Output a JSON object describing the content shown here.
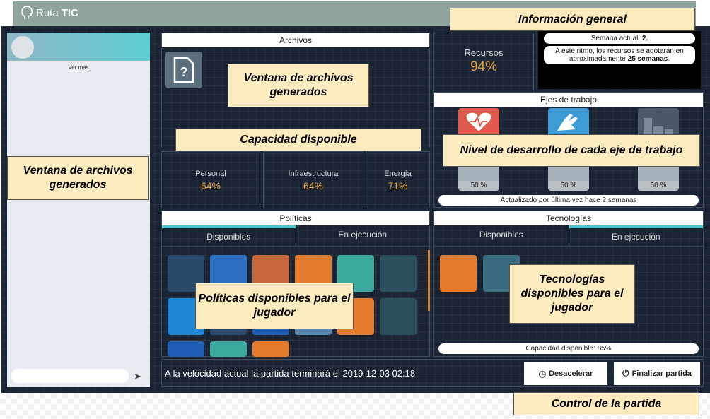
{
  "app": {
    "logo_prefix": "Ruta",
    "logo_suffix": "TIC"
  },
  "sidebar": {
    "ver_mas": "Ver mas"
  },
  "archivos": {
    "title": "Archivos",
    "file_icon": "question-document-icon"
  },
  "recursos": {
    "label": "Recursos",
    "value": "94%"
  },
  "info": {
    "semana_prefix": "Semana actual: ",
    "semana_value": "2.",
    "ritmo_prefix": "A este ritmo, los recursos se agotarán en aproximadamente ",
    "ritmo_value": "25 semanas",
    "ritmo_suffix": "."
  },
  "capacidad": [
    {
      "label": "Personal",
      "value": "64%"
    },
    {
      "label": "Infraestructura",
      "value": "64%"
    },
    {
      "label": "Energía",
      "value": "71%"
    }
  ],
  "ejes": {
    "title": "Ejes de trabajo",
    "items": [
      {
        "icon": "heart-pulse-icon",
        "color": "#e05a4e",
        "pct": "50 %"
      },
      {
        "icon": "hand-heart-icon",
        "color": "#3d9bd6",
        "pct": "50 %"
      },
      {
        "icon": "city-buildings-icon",
        "color": "#4b5868",
        "pct": "50 %"
      }
    ],
    "updated": "Actualizado por última vez hace 2 semanas"
  },
  "politicas": {
    "title": "Políticas",
    "tabs": [
      "Disponibles",
      "En ejecución"
    ],
    "tiles": [
      {
        "icon": "brain-energy-icon",
        "color": "#2b4a6b"
      },
      {
        "icon": "mobile-search-icon",
        "color": "#2d6fc0"
      },
      {
        "icon": "smart-home-icon",
        "color": "#c9673c"
      },
      {
        "icon": "laptop-soccer-icon",
        "color": "#e47a2b"
      },
      {
        "icon": "network-users-icon",
        "color": "#3aa99e"
      },
      {
        "icon": "farm-plant-icon",
        "color": "#2c4f5e"
      },
      {
        "icon": "laptop-icon",
        "color": "#1e88d8"
      },
      {
        "icon": "school-board-icon",
        "color": "#2b4a6b"
      },
      {
        "icon": "classroom-cloud-icon",
        "color": "#1e5fb5"
      },
      {
        "icon": "hand-care-icon",
        "color": "#5a87b0"
      },
      {
        "icon": "sunrise-icon",
        "color": "#e47a2b"
      },
      {
        "icon": "desk-icon",
        "color": "#2c4f5e"
      },
      {
        "icon": "monitor-icon",
        "color": "#1e5fb5"
      },
      {
        "icon": "screen-icon",
        "color": "#3aa99e"
      },
      {
        "icon": "sun-factory-icon",
        "color": "#e47a2b"
      }
    ]
  },
  "tecnologias": {
    "title": "Tecnologías",
    "tabs": [
      "Disponibles",
      "En ejecución"
    ],
    "tiles": [
      {
        "icon": "circuit-map-icon",
        "color": "#e47a2b"
      },
      {
        "icon": "binoculars-icon",
        "color": "#3b6b7e"
      }
    ],
    "capacidad": "Capacidad disponible: 85%"
  },
  "control": {
    "text_prefix": "A la velocidad actual la partida terminará el ",
    "date": "2019-12-03 02:18",
    "decelerar": "Desacelerar",
    "finalizar": "Finalizar partida"
  },
  "annotations": {
    "info_general": "Información general",
    "archivos_generados": "Ventana de archivos generados",
    "capacidad_disponible": "Capacidad disponible",
    "nivel_desarrollo": "Nivel de desarrollo de cada eje de trabajo",
    "sidebar_archivos": "Ventana de archivos generados",
    "politicas_disponibles": "Políticas disponibles para el jugador",
    "tecnologias_disponibles": "Tecnologías disponibles para el jugador",
    "control_partida": "Control de la partida"
  }
}
